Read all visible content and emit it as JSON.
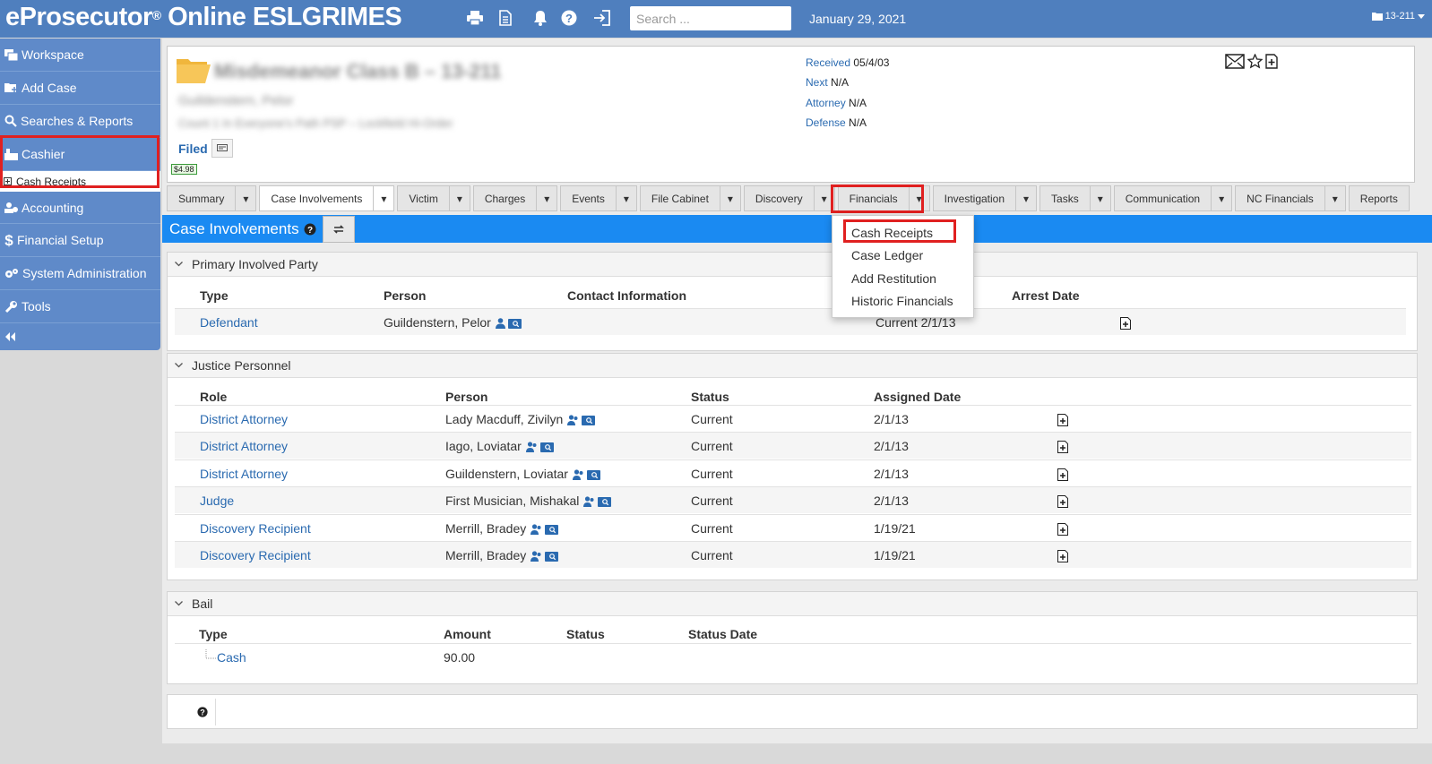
{
  "app": {
    "title": "eProsecutor",
    "reg": "®",
    "title_rest": " Online ESLGRIMES"
  },
  "topbar": {
    "icons": [
      "print-icon",
      "document-icon",
      "bell-icon",
      "help-icon",
      "logout-icon"
    ],
    "search_placeholder": "Search ...",
    "date": "January 29, 2021",
    "case_number": "13-211"
  },
  "sidebar": {
    "items": [
      {
        "label": "Workspace",
        "icon": "workspace-icon"
      },
      {
        "label": "Add Case",
        "icon": "add-case-icon"
      },
      {
        "label": "Searches & Reports",
        "icon": "search-icon"
      },
      {
        "label": "Cashier",
        "icon": "cashier-icon"
      },
      {
        "label": "Accounting",
        "icon": "accounting-icon"
      },
      {
        "label": "Financial Setup",
        "icon": "dollar-icon"
      },
      {
        "label": "System Administration",
        "icon": "gears-icon"
      },
      {
        "label": "Tools",
        "icon": "wrench-icon"
      }
    ],
    "sub_item": "Cash Receipts"
  },
  "case": {
    "title": "Misdemeanor Class B – 13-211",
    "line2": "Guildenstern, Pelor",
    "line3": "Count 1 In Everyone's Path PSP – Lockfield Hi-Order",
    "filed": "Filed",
    "amount": "$4.98",
    "meta": [
      {
        "label": "Received",
        "value": "05/4/03"
      },
      {
        "label": "Next",
        "value": "N/A"
      },
      {
        "label": "Attorney",
        "value": "N/A"
      },
      {
        "label": "Defense",
        "value": "N/A"
      }
    ]
  },
  "tabs": [
    {
      "label": "Summary",
      "caret": true
    },
    {
      "label": "Case Involvements",
      "caret": true,
      "active": true
    },
    {
      "label": "Victim",
      "caret": true
    },
    {
      "label": "Charges",
      "caret": true
    },
    {
      "label": "Events",
      "caret": true
    },
    {
      "label": "File Cabinet",
      "caret": true
    },
    {
      "label": "Discovery",
      "caret": true
    },
    {
      "label": "Financials",
      "caret": true
    },
    {
      "label": "Investigation",
      "caret": true
    },
    {
      "label": "Tasks",
      "caret": true
    },
    {
      "label": "Communication",
      "caret": true
    },
    {
      "label": "NC Financials",
      "caret": true
    },
    {
      "label": "Reports",
      "caret": false
    }
  ],
  "financials_menu": [
    "Cash Receipts",
    "Case Ledger",
    "Add Restitution",
    "Historic Financials"
  ],
  "section_title": "Case Involvements",
  "primary": {
    "title": "Primary Involved Party",
    "headers": [
      "Type",
      "Person",
      "Contact Information",
      "Arrest Date"
    ],
    "rows": [
      {
        "type": "Defendant",
        "person": "Guildenstern, Pelor",
        "status": "Current 2/1/13"
      }
    ]
  },
  "justice": {
    "title": "Justice Personnel",
    "headers": [
      "Role",
      "Person",
      "Status",
      "Assigned Date"
    ],
    "rows": [
      {
        "role": "District Attorney",
        "person": "Lady Macduff, Zivilyn",
        "status": "Current",
        "date": "2/1/13"
      },
      {
        "role": "District Attorney",
        "person": "Iago, Loviatar",
        "status": "Current",
        "date": "2/1/13"
      },
      {
        "role": "District Attorney",
        "person": "Guildenstern, Loviatar",
        "status": "Current",
        "date": "2/1/13"
      },
      {
        "role": "Judge",
        "person": "First Musician, Mishakal",
        "status": "Current",
        "date": "2/1/13"
      },
      {
        "role": "Discovery Recipient",
        "person": "Merrill, Bradey",
        "status": "Current",
        "date": "1/19/21"
      },
      {
        "role": "Discovery Recipient",
        "person": "Merrill, Bradey",
        "status": "Current",
        "date": "1/19/21"
      }
    ]
  },
  "bail": {
    "title": "Bail",
    "headers": [
      "Type",
      "Amount",
      "Status",
      "Status Date"
    ],
    "rows": [
      {
        "type": "Cash",
        "amount": "90.00"
      }
    ]
  },
  "colors": {
    "topbar": "#4f7fbe",
    "sidebar": "#5f8ac9",
    "section": "#1a8af2",
    "link": "#2a6ab0",
    "highlight": "#e02020"
  }
}
